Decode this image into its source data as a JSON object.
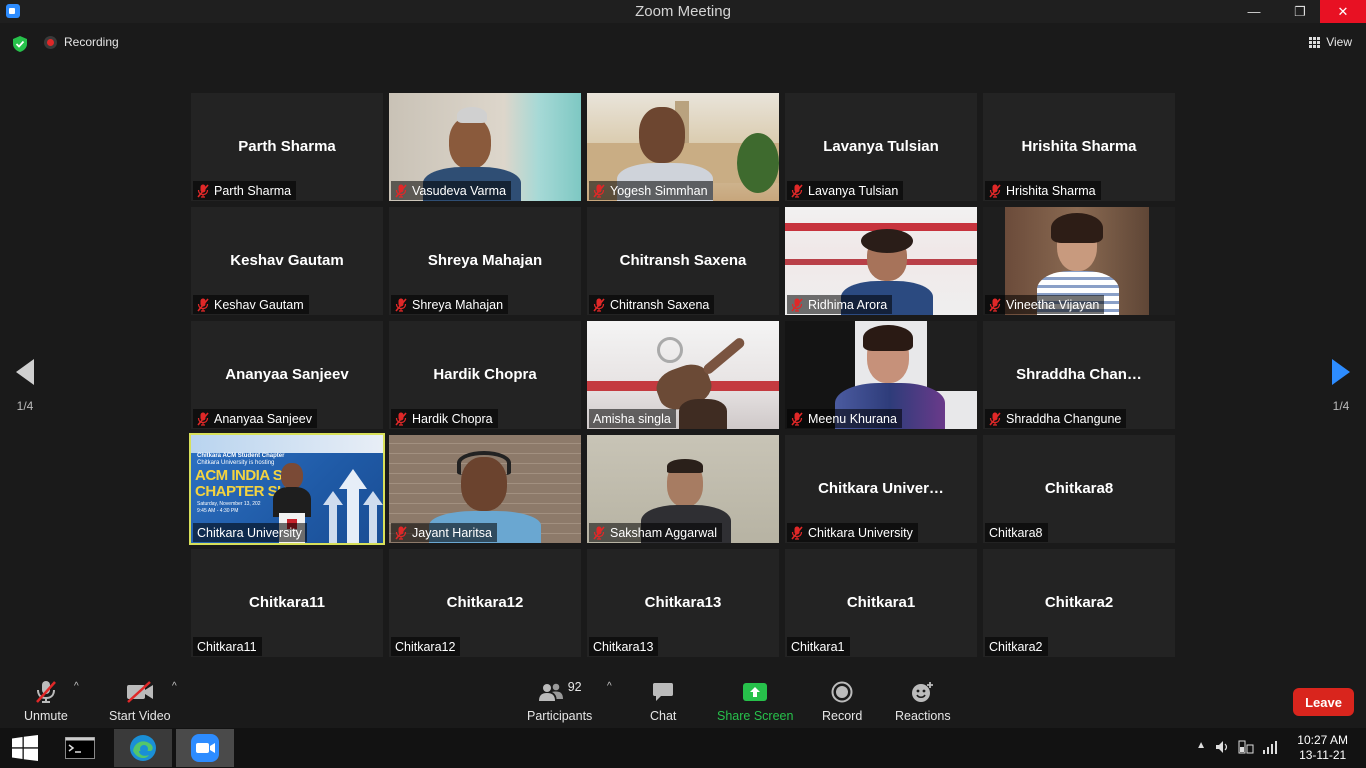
{
  "window": {
    "title": "Zoom Meeting"
  },
  "meeting_bar": {
    "recording_label": "Recording",
    "view_label": "View"
  },
  "pager": {
    "left_label": "1/4",
    "right_label": "1/4"
  },
  "tiles": [
    {
      "big_name": "Parth Sharma",
      "label": "Parth Sharma",
      "muted": true,
      "video": false
    },
    {
      "big_name": "",
      "label": "Vasudeva Varma",
      "muted": true,
      "video": true
    },
    {
      "big_name": "",
      "label": "Yogesh Simmhan",
      "muted": true,
      "video": true
    },
    {
      "big_name": "Lavanya Tulsian",
      "label": "Lavanya Tulsian",
      "muted": true,
      "video": false
    },
    {
      "big_name": "Hrishita Sharma",
      "label": "Hrishita Sharma",
      "muted": true,
      "video": false
    },
    {
      "big_name": "Keshav Gautam",
      "label": "Keshav Gautam",
      "muted": true,
      "video": false
    },
    {
      "big_name": "Shreya Mahajan",
      "label": "Shreya Mahajan",
      "muted": true,
      "video": false
    },
    {
      "big_name": "Chitransh Saxena",
      "label": "Chitransh Saxena",
      "muted": true,
      "video": false
    },
    {
      "big_name": "",
      "label": "Ridhima Arora",
      "muted": true,
      "video": true
    },
    {
      "big_name": "",
      "label": "Vineetha Vijayan",
      "muted": true,
      "video": true
    },
    {
      "big_name": "Ananyaa Sanjeev",
      "label": "Ananyaa Sanjeev",
      "muted": true,
      "video": false
    },
    {
      "big_name": "Hardik Chopra",
      "label": "Hardik Chopra",
      "muted": true,
      "video": false
    },
    {
      "big_name": "",
      "label": "Amisha singla",
      "muted": false,
      "video": true
    },
    {
      "big_name": "",
      "label": "Meenu Khurana",
      "muted": true,
      "video": true
    },
    {
      "big_name": "Shraddha  Chan…",
      "label": "Shraddha Changune",
      "muted": true,
      "video": false
    },
    {
      "big_name": "",
      "label": "Chitkara University",
      "muted": false,
      "video": true,
      "active": true
    },
    {
      "big_name": "",
      "label": "Jayant Haritsa",
      "muted": true,
      "video": true
    },
    {
      "big_name": "",
      "label": "Saksham Aggarwal",
      "muted": true,
      "video": true
    },
    {
      "big_name": "Chitkara  Univer…",
      "label": "Chitkara University",
      "muted": true,
      "video": false
    },
    {
      "big_name": "Chitkara8",
      "label": "Chitkara8",
      "muted": false,
      "video": false
    },
    {
      "big_name": "Chitkara11",
      "label": "Chitkara11",
      "muted": false,
      "video": false
    },
    {
      "big_name": "Chitkara12",
      "label": "Chitkara12",
      "muted": false,
      "video": false
    },
    {
      "big_name": "Chitkara13",
      "label": "Chitkara13",
      "muted": false,
      "video": false
    },
    {
      "big_name": "Chitkara1",
      "label": "Chitkara1",
      "muted": false,
      "video": false
    },
    {
      "big_name": "Chitkara2",
      "label": "Chitkara2",
      "muted": false,
      "video": false
    }
  ],
  "slide": {
    "line1": "Chitkara ACM Student Chapter",
    "line2": "Chitkara University is hosting",
    "headline1": "ACM INDIA ST",
    "headline2": "CHAPTER SU",
    "date": "Saturday, November 13, 202",
    "time": "9:45 AM - 4:30 PM"
  },
  "toolbar": {
    "unmute": "Unmute",
    "start_video": "Start Video",
    "participants": "Participants",
    "participants_count": "92",
    "chat": "Chat",
    "share_screen": "Share Screen",
    "record": "Record",
    "reactions": "Reactions",
    "leave": "Leave"
  },
  "taskbar": {
    "time": "10:27 AM",
    "date": "13-11-21"
  },
  "colors": {
    "accent": "#2d8cff",
    "share_green": "#27c14b",
    "leave_red": "#d9251d",
    "active_speaker": "#d8e05a",
    "muted_red": "#e02828"
  }
}
